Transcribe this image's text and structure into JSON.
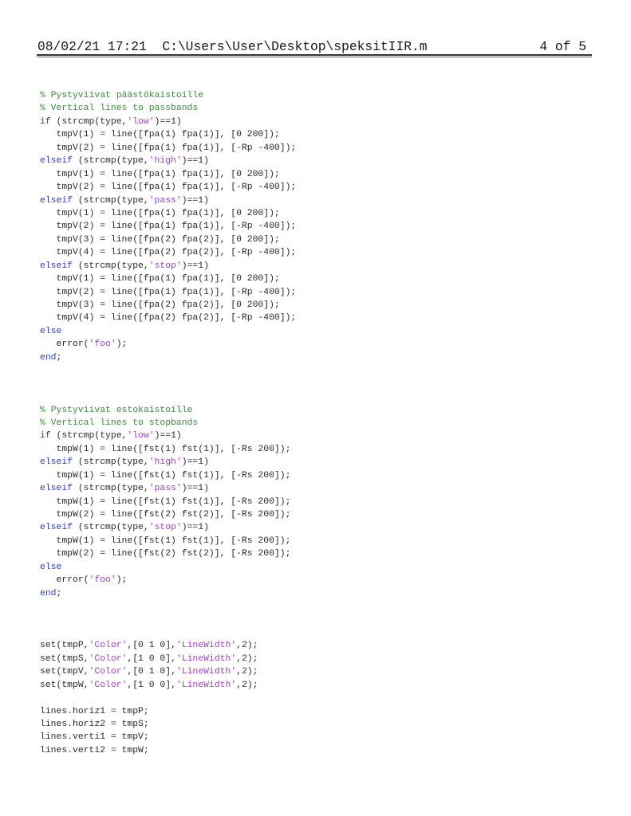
{
  "header": {
    "datetime": "08/02/21 17:21",
    "filepath": "C:\\Users\\User\\Desktop\\speksitIIR.m",
    "page": "4 of 5"
  },
  "colors": {
    "comment": "#3c8a3c",
    "keyword": "#2a3cd0",
    "string": "#a040c8",
    "text": "#2a2a2a"
  },
  "code_lines": [
    [
      [
        "cm",
        "% Pystyviivat päästökaistoille"
      ]
    ],
    [
      [
        "cm",
        "% Vertical lines to passbands"
      ]
    ],
    [
      [
        "kw",
        "if"
      ],
      [
        "t",
        " (strcmp(type,"
      ],
      [
        "str",
        "'low'"
      ],
      [
        "t",
        ")==1)"
      ]
    ],
    [
      [
        "t",
        "   tmpV(1) = line([fpa(1) fpa(1)], [0 200]);"
      ]
    ],
    [
      [
        "t",
        "   tmpV(2) = line([fpa(1) fpa(1)], [-Rp -400]);"
      ]
    ],
    [
      [
        "kw",
        "elseif"
      ],
      [
        "t",
        " (strcmp(type,"
      ],
      [
        "str",
        "'high'"
      ],
      [
        "t",
        ")==1)"
      ]
    ],
    [
      [
        "t",
        "   tmpV(1) = line([fpa(1) fpa(1)], [0 200]);"
      ]
    ],
    [
      [
        "t",
        "   tmpV(2) = line([fpa(1) fpa(1)], [-Rp -400]);"
      ]
    ],
    [
      [
        "kw",
        "elseif"
      ],
      [
        "t",
        " (strcmp(type,"
      ],
      [
        "str",
        "'pass'"
      ],
      [
        "t",
        ")==1)"
      ]
    ],
    [
      [
        "t",
        "   tmpV(1) = line([fpa(1) fpa(1)], [0 200]);"
      ]
    ],
    [
      [
        "t",
        "   tmpV(2) = line([fpa(1) fpa(1)], [-Rp -400]);"
      ]
    ],
    [
      [
        "t",
        "   tmpV(3) = line([fpa(2) fpa(2)], [0 200]);"
      ]
    ],
    [
      [
        "t",
        "   tmpV(4) = line([fpa(2) fpa(2)], [-Rp -400]);"
      ]
    ],
    [
      [
        "kw",
        "elseif"
      ],
      [
        "t",
        " (strcmp(type,"
      ],
      [
        "str",
        "'stop'"
      ],
      [
        "t",
        ")==1)"
      ]
    ],
    [
      [
        "t",
        "   tmpV(1) = line([fpa(1) fpa(1)], [0 200]);"
      ]
    ],
    [
      [
        "t",
        "   tmpV(2) = line([fpa(1) fpa(1)], [-Rp -400]);"
      ]
    ],
    [
      [
        "t",
        "   tmpV(3) = line([fpa(2) fpa(2)], [0 200]);"
      ]
    ],
    [
      [
        "t",
        "   tmpV(4) = line([fpa(2) fpa(2)], [-Rp -400]);"
      ]
    ],
    [
      [
        "kw",
        "else"
      ]
    ],
    [
      [
        "t",
        "   error("
      ],
      [
        "str",
        "'foo'"
      ],
      [
        "t",
        ");"
      ]
    ],
    [
      [
        "kw",
        "end"
      ],
      [
        "t",
        ";"
      ]
    ],
    [],
    [],
    [],
    [
      [
        "cm",
        "% Pystyviivat estokaistoille"
      ]
    ],
    [
      [
        "cm",
        "% Vertical lines to stopbands"
      ]
    ],
    [
      [
        "kw",
        "if"
      ],
      [
        "t",
        " (strcmp(type,"
      ],
      [
        "str",
        "'low'"
      ],
      [
        "t",
        ")==1)"
      ]
    ],
    [
      [
        "t",
        "   tmpW(1) = line([fst(1) fst(1)], [-Rs 200]);"
      ]
    ],
    [
      [
        "kw",
        "elseif"
      ],
      [
        "t",
        " (strcmp(type,"
      ],
      [
        "str",
        "'high'"
      ],
      [
        "t",
        ")==1)"
      ]
    ],
    [
      [
        "t",
        "   tmpW(1) = line([fst(1) fst(1)], [-Rs 200]);"
      ]
    ],
    [
      [
        "kw",
        "elseif"
      ],
      [
        "t",
        " (strcmp(type,"
      ],
      [
        "str",
        "'pass'"
      ],
      [
        "t",
        ")==1)"
      ]
    ],
    [
      [
        "t",
        "   tmpW(1) = line([fst(1) fst(1)], [-Rs 200]);"
      ]
    ],
    [
      [
        "t",
        "   tmpW(2) = line([fst(2) fst(2)], [-Rs 200]);"
      ]
    ],
    [
      [
        "kw",
        "elseif"
      ],
      [
        "t",
        " (strcmp(type,"
      ],
      [
        "str",
        "'stop'"
      ],
      [
        "t",
        ")==1)"
      ]
    ],
    [
      [
        "t",
        "   tmpW(1) = line([fst(1) fst(1)], [-Rs 200]);"
      ]
    ],
    [
      [
        "t",
        "   tmpW(2) = line([fst(2) fst(2)], [-Rs 200]);"
      ]
    ],
    [
      [
        "kw",
        "else"
      ]
    ],
    [
      [
        "t",
        "   error("
      ],
      [
        "str",
        "'foo'"
      ],
      [
        "t",
        ");"
      ]
    ],
    [
      [
        "kw",
        "end"
      ],
      [
        "t",
        ";"
      ]
    ],
    [],
    [],
    [],
    [
      [
        "t",
        "set(tmpP,"
      ],
      [
        "str",
        "'Color'"
      ],
      [
        "t",
        ",[0 1 0],"
      ],
      [
        "str",
        "'LineWidth'"
      ],
      [
        "t",
        ",2);"
      ]
    ],
    [
      [
        "t",
        "set(tmpS,"
      ],
      [
        "str",
        "'Color'"
      ],
      [
        "t",
        ",[1 0 0],"
      ],
      [
        "str",
        "'LineWidth'"
      ],
      [
        "t",
        ",2);"
      ]
    ],
    [
      [
        "t",
        "set(tmpV,"
      ],
      [
        "str",
        "'Color'"
      ],
      [
        "t",
        ",[0 1 0],"
      ],
      [
        "str",
        "'LineWidth'"
      ],
      [
        "t",
        ",2);"
      ]
    ],
    [
      [
        "t",
        "set(tmpW,"
      ],
      [
        "str",
        "'Color'"
      ],
      [
        "t",
        ",[1 0 0],"
      ],
      [
        "str",
        "'LineWidth'"
      ],
      [
        "t",
        ",2);"
      ]
    ],
    [],
    [
      [
        "t",
        "lines.horiz1 = tmpP;"
      ]
    ],
    [
      [
        "t",
        "lines.horiz2 = tmpS;"
      ]
    ],
    [
      [
        "t",
        "lines.verti1 = tmpV;"
      ]
    ],
    [
      [
        "t",
        "lines.verti2 = tmpW;"
      ]
    ]
  ]
}
